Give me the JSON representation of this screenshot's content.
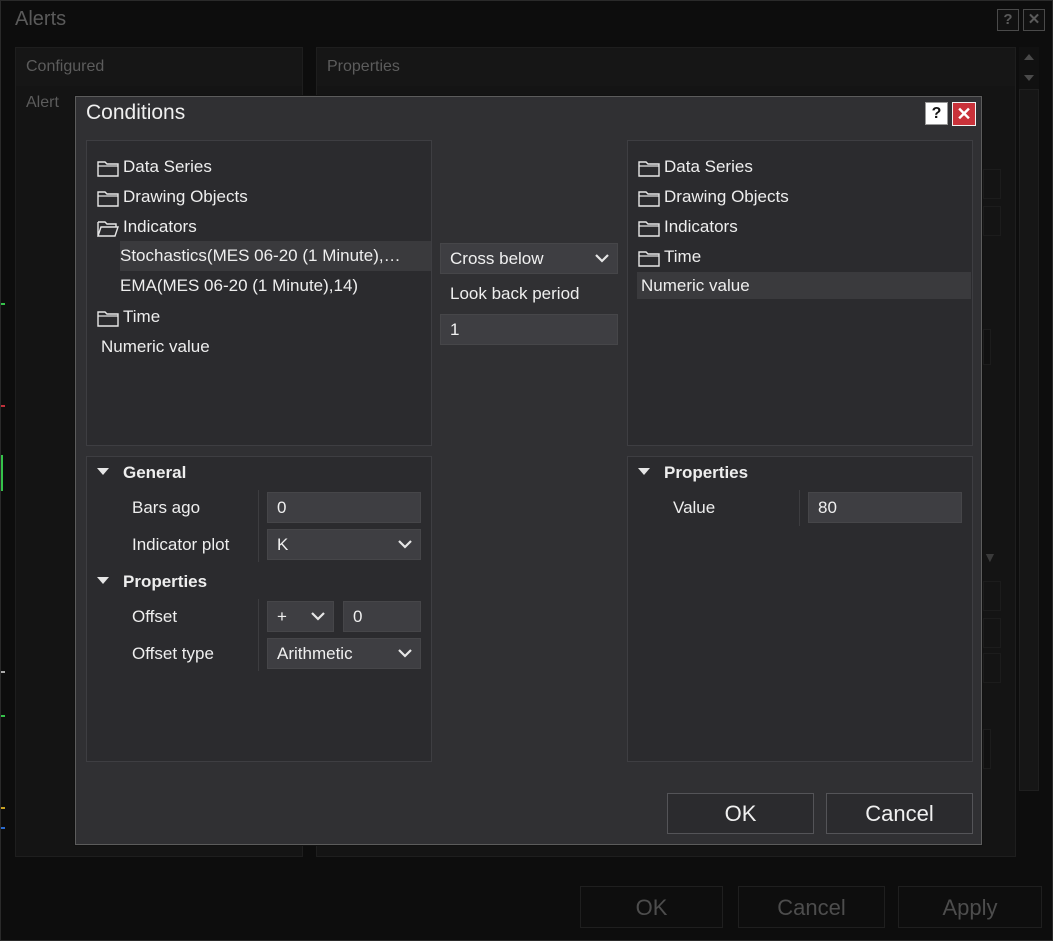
{
  "alerts_window": {
    "title": "Alerts",
    "help_glyph": "?",
    "close_glyph": "✕",
    "configured_header": "Configured",
    "properties_header": "Properties",
    "alert_column": "Alert",
    "ok_label": "OK",
    "cancel_label": "Cancel",
    "apply_label": "Apply"
  },
  "conditions_dialog": {
    "title": "Conditions",
    "help_glyph": "?",
    "close_glyph": "✕",
    "left_tree": {
      "items": [
        "Data Series",
        "Drawing Objects",
        "Indicators"
      ],
      "indicator_children": [
        "Stochastics(MES 06-20 (1 Minute),…",
        "EMA(MES 06-20 (1 Minute),14)"
      ],
      "time_item": "Time",
      "numeric_item": "Numeric value",
      "selected": "Stochastics(MES 06-20 (1 Minute),…"
    },
    "middle": {
      "condition_value": "Cross below",
      "look_back_label": "Look back period",
      "look_back_value": "1"
    },
    "right_tree": {
      "items": [
        "Data Series",
        "Drawing Objects",
        "Indicators",
        "Time"
      ],
      "numeric_item": "Numeric value",
      "selected": "Numeric value"
    },
    "left_properties": {
      "general_header": "General",
      "bars_ago_label": "Bars ago",
      "bars_ago_value": "0",
      "indicator_plot_label": "Indicator plot",
      "indicator_plot_value": "K",
      "properties_header": "Properties",
      "offset_label": "Offset",
      "offset_sign": "+",
      "offset_value": "0",
      "offset_type_label": "Offset type",
      "offset_type_value": "Arithmetic"
    },
    "right_properties": {
      "properties_header": "Properties",
      "value_label": "Value",
      "value_value": "80"
    },
    "ok_label": "OK",
    "cancel_label": "Cancel"
  },
  "colors": {
    "dialog_bg": "#303033",
    "panel_bg": "#2b2b2e",
    "field_bg": "#3e3e42",
    "close_red": "#c9323a",
    "text": "#eeeeee"
  }
}
